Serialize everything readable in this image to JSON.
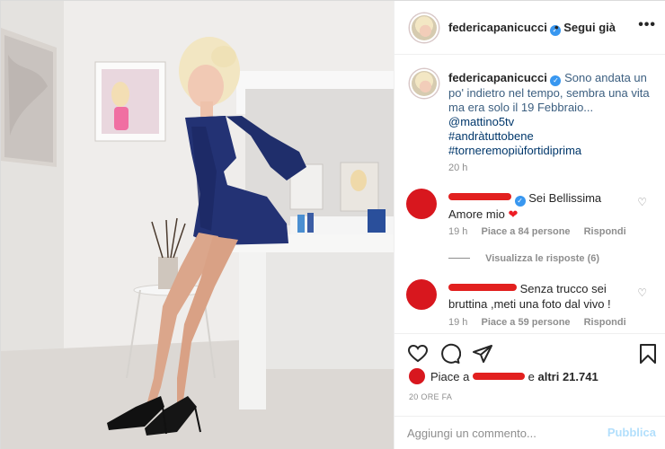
{
  "header": {
    "username": "federicapanicucci",
    "follow_dot": "•",
    "follow_label": "Segui già",
    "more_label": "•••"
  },
  "caption": {
    "username": "federicapanicucci",
    "text": "Sono andata un po' indietro nel tempo, sembra una vita ma era solo il 19 Febbraio...",
    "mention": "@mattino5tv",
    "hashtags": [
      "#andràtuttobene",
      "#torneremopiùfortidiprima"
    ],
    "time": "20 h"
  },
  "comments": [
    {
      "text": "Sei Bellissima Amore mio",
      "emoji": "❤",
      "time": "19 h",
      "likes": "Piace a 84 persone",
      "reply_label": "Rispondi"
    },
    {
      "text": "Senza trucco sei bruttina ,meti una foto dal vivo !",
      "time": "19 h",
      "likes": "Piace a 59 persone",
      "reply_label": "Rispondi"
    }
  ],
  "view_replies_label": "Visualizza le risposte (6)",
  "likes_summary": {
    "prefix": "Piace a",
    "middle": "e",
    "others": "altri 21.741"
  },
  "time_ago": "20 ORE FA",
  "add_comment": {
    "placeholder": "Aggiungi un commento...",
    "publish_label": "Pubblica"
  },
  "icons": {
    "like": "heart-icon",
    "comment": "comment-icon",
    "share": "share-icon",
    "save": "bookmark-icon",
    "verified": "verified-badge-icon",
    "more": "more-options-icon"
  },
  "colors": {
    "verified": "#3897f0",
    "link": "#00376b",
    "publish_disabled": "#b2dffc",
    "redaction": "#e2201f"
  }
}
